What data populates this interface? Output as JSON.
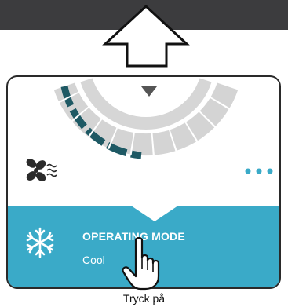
{
  "icons": {
    "up_arrow": "up-arrow-icon",
    "dial_marker": "triangle-down-icon",
    "fan": "fan-icon",
    "more": "more-icon",
    "operating_mode": "snowflake-icon",
    "pointer": "hand-pointer-icon"
  },
  "colors": {
    "topbar": "#3c3c3e",
    "panel": "#3aaac8",
    "dial_active": "#1e5964",
    "dial_inactive": "#d4d4d4",
    "more_dots": "#3aaac8"
  },
  "mode": {
    "title": "OPERATING MODE",
    "value": "Cool"
  },
  "caption": "Tryck på"
}
